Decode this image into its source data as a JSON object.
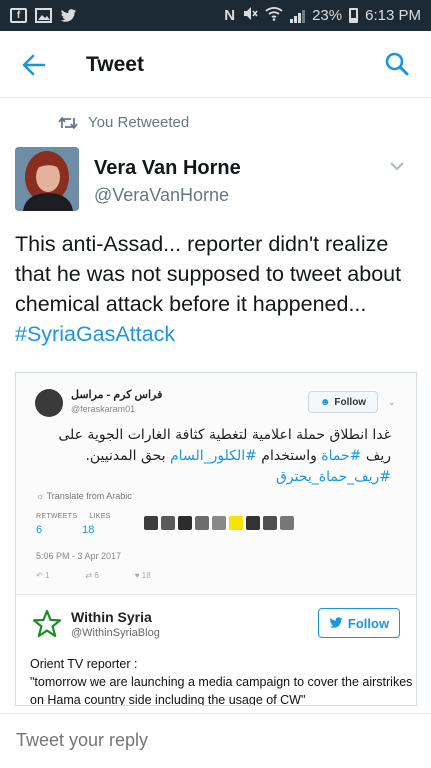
{
  "status_bar": {
    "battery_percent": "23%",
    "time": "6:13 PM",
    "left_icons": [
      "facebook-icon",
      "gallery-icon",
      "twitter-icon"
    ],
    "right_icons": [
      "nfc-icon",
      "mute-icon",
      "wifi-icon",
      "signal-icon",
      "battery-icon"
    ]
  },
  "app_bar": {
    "title": "Tweet"
  },
  "retweet": {
    "label": "You Retweeted"
  },
  "author": {
    "name": "Vera Van Horne",
    "handle": "@VeraVanHorne"
  },
  "tweet": {
    "text": "This anti-Assad... reporter didn't realize that he was not supposed to tweet about chemical attack before it happened... ",
    "hashtag": "#SyriaGasAttack"
  },
  "embedded_image": {
    "quoted_tweet": {
      "name": "فراس كرم - مراسل",
      "handle": "@feraskaram01",
      "follow_label": "Follow",
      "text_plain": "غدا انطلاق حملة اعلامية لتغطية كثافة الغارات الجوية على ريف ",
      "text_hash1": "#حماة",
      "text_mid": " واستخدام ",
      "text_hash2": "#الكلور_السام",
      "text_end": " بحق المدنيين.",
      "text_hash3": "#ريف_حماة_يحترق",
      "translate_label": "Translate from Arabic",
      "retweets_label": "RETWEETS",
      "likes_label": "LIKES",
      "retweets": "6",
      "likes": "18",
      "date": "5:06 PM - 3 Apr 2017",
      "action_reply": "1",
      "action_retweet": "6",
      "action_like": "18"
    },
    "commenter": {
      "name": "Within Syria",
      "handle": "@WithinSyriaBlog",
      "follow_label": "Follow",
      "text_line1": "Orient TV reporter :",
      "text_line2": "\"tomorrow we are launching a media campaign to cover the airstrikes on Hama country side including the usage of CW\""
    }
  },
  "reply": {
    "placeholder": "Tweet your reply"
  },
  "colors": {
    "status_bar_bg": "#1c2a35",
    "accent": "#1b95e0",
    "secondary_text": "#657786"
  }
}
